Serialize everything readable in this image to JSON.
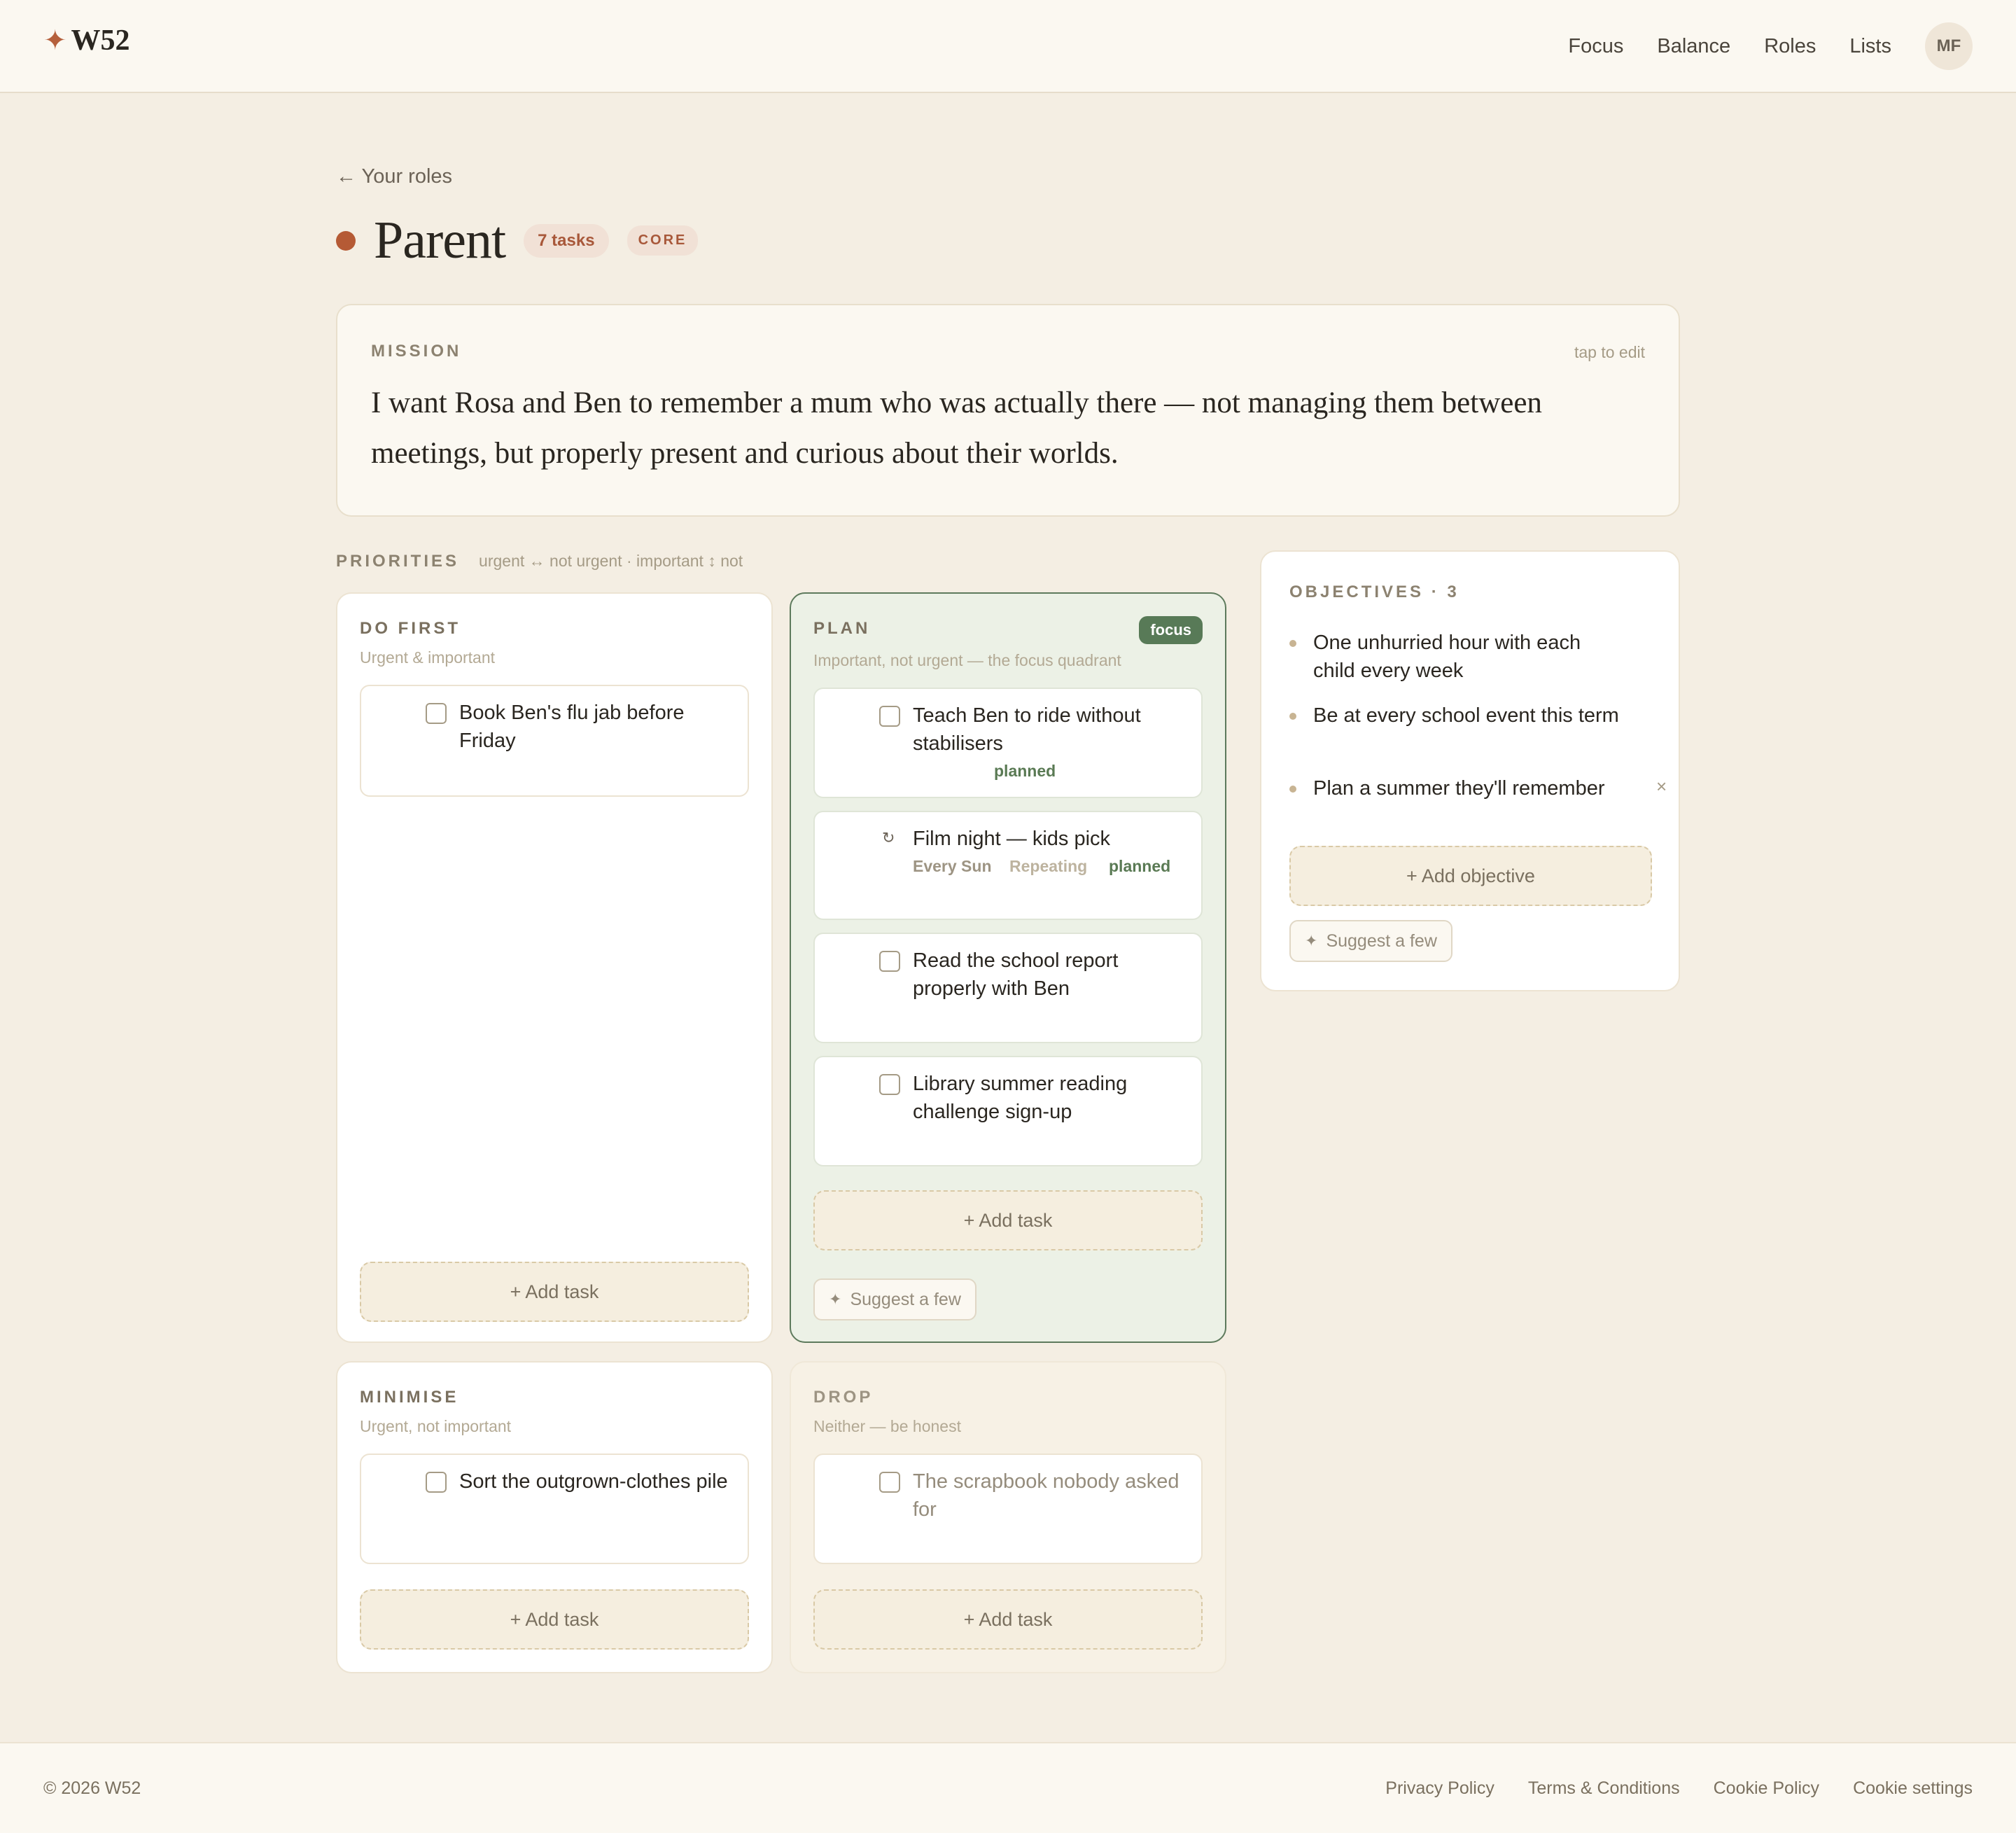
{
  "brand": {
    "star": "✦",
    "name": "W52"
  },
  "nav": {
    "items": [
      "Focus",
      "Balance",
      "Roles",
      "Lists"
    ],
    "avatar": "MF"
  },
  "back_link": "← Your roles",
  "role": {
    "title": "Parent",
    "task_count": "7 tasks",
    "tag": "CORE",
    "color": "#b55a35"
  },
  "mission": {
    "label": "MISSION",
    "edit_hint": "tap to edit",
    "text": "I want Rosa and Ben to remember a mum who was actually there — not managing them between meetings, but properly present and curious about their worlds."
  },
  "priorities": {
    "label": "PRIORITIES",
    "legend": "urgent ↔ not urgent · important ↕ not",
    "add_task_label": "+ Add task",
    "suggest_label": "Suggest a few",
    "quadrants": {
      "do_first": {
        "title": "DO FIRST",
        "subtitle": "Urgent & important",
        "tasks": [
          {
            "text": "Book Ben's flu jab before Friday"
          }
        ]
      },
      "plan": {
        "title": "PLAN",
        "subtitle": "Important, not urgent — the focus quadrant",
        "badge": "focus",
        "tasks": [
          {
            "text": "Teach Ben to ride without stabilisers",
            "status": "planned"
          },
          {
            "text": "Film night — kids pick",
            "schedule": "Every Sun",
            "repeat": "Repeating",
            "status": "planned"
          },
          {
            "text": "Read the school report properly with Ben"
          },
          {
            "text": "Library summer reading challenge sign-up"
          }
        ]
      },
      "minimise": {
        "title": "MINIMISE",
        "subtitle": "Urgent, not important",
        "tasks": [
          {
            "text": "Sort the outgrown-clothes pile"
          }
        ]
      },
      "drop": {
        "title": "DROP",
        "subtitle": "Neither — be honest",
        "tasks": [
          {
            "text": "The scrapbook nobody asked for"
          }
        ]
      }
    }
  },
  "objectives": {
    "title": "OBJECTIVES · 3",
    "items": [
      "One unhurried hour with each child every week",
      "Be at every school event this term",
      "Plan a summer they'll remember"
    ],
    "remove_icon": "×",
    "add_label": "+ Add objective",
    "suggest_label": "Suggest a few"
  },
  "footer": {
    "copyright": "© 2026 W52",
    "links": [
      "Privacy Policy",
      "Terms & Conditions",
      "Cookie Policy",
      "Cookie settings"
    ]
  }
}
